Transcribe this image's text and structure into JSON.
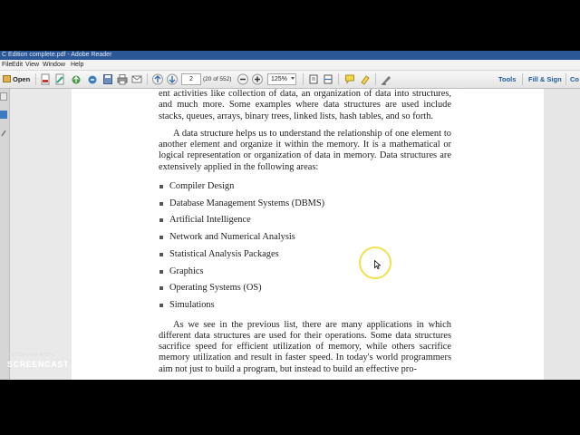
{
  "window": {
    "title": "C Edition complete.pdf - Adobe Reader"
  },
  "menu": [
    "File",
    "Edit",
    "View",
    "Window",
    "Help"
  ],
  "toolbar": {
    "open_label": "Open",
    "page_value": "2",
    "page_count": "(20 of 552)",
    "zoom_value": "125%",
    "tools_label": "Tools",
    "fill_sign_label": "Fill & Sign",
    "comment_label": "Co"
  },
  "document": {
    "para1": "ent activities like collection of data, an organization of data into structures, and much more. Some examples where data structures are used include stacks, queues, arrays, binary trees, linked lists, hash tables, and so forth.",
    "para2": "A data structure helps us to understand the relationship of one element to another element and organize it within the memory. It is a mathematical or logical representation or organization of data in memory. Data structures are extensively applied in the following areas:",
    "bullets": [
      "Compiler Design",
      "Database Management Systems (DBMS)",
      "Artificial Intelligence",
      "Network and Numerical Analysis",
      "Statistical Analysis Packages",
      "Graphics",
      "Operating Systems (OS)",
      "Simulations"
    ],
    "para3": "As we see in the previous list, there are many applications in which different data structures are used for their operations. Some data structures sacrifice speed for efficient utilization of memory, while others sacrifice memory utilization and result in faster speed. In today's world programmers aim not just to build a program, but instead to build an effective pro-"
  },
  "watermark": {
    "line1": "RECORDED WITH",
    "line2": "SCREENCAST",
    "line3": "MATIC"
  },
  "colors": {
    "titlebar": "#2b5797",
    "link_blue": "#1f5c99",
    "highlight_ring": "#f2e04c"
  }
}
